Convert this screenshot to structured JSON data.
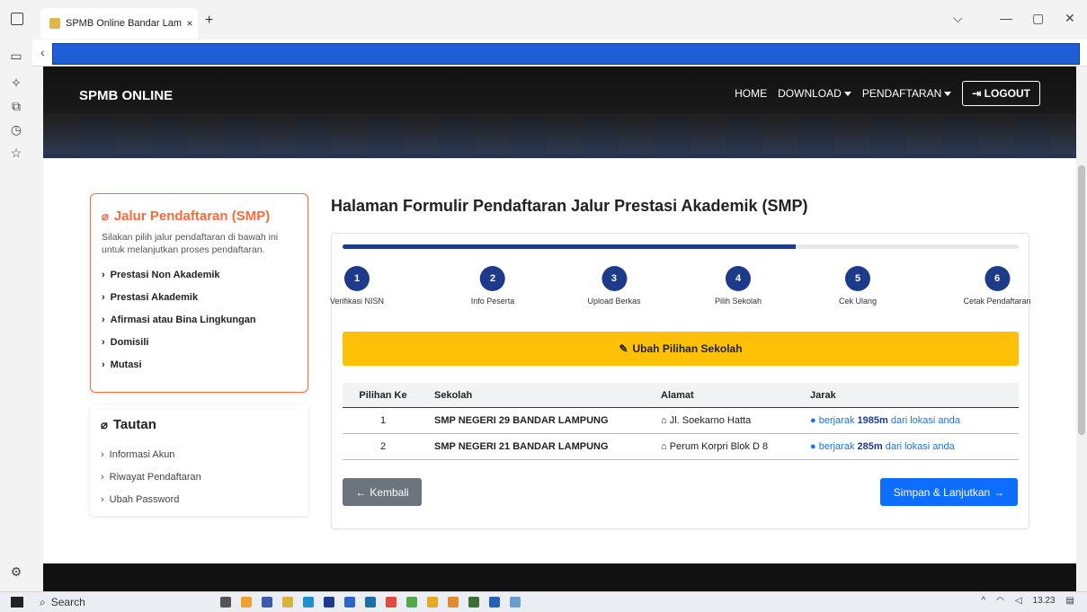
{
  "browser": {
    "tab_title": "SPMB Online Bandar Lampung",
    "tab_close": "×",
    "new_tab": "+",
    "win_min": "—",
    "win_max": "▢",
    "win_close": "✕",
    "dropdown": "⌵"
  },
  "header": {
    "brand": "SPMB ONLINE",
    "nav": [
      "HOME",
      "DOWNLOAD",
      "PENDAFTARAN"
    ],
    "logout": "LOGOUT"
  },
  "jalur_card": {
    "title": "Jalur Pendaftaran (SMP)",
    "description": "Silakan pilih jalur pendaftaran di bawah ini untuk melanjutkan proses pendaftaran.",
    "items": [
      "Prestasi Non Akademik",
      "Prestasi Akademik",
      "Afirmasi atau Bina Lingkungan",
      "Domisili",
      "Mutasi"
    ]
  },
  "tautan_card": {
    "title": "Tautan",
    "items": [
      "Informasi Akun",
      "Riwayat Pendaftaran",
      "Ubah Password"
    ]
  },
  "page_title": "Halaman Formulir Pendaftaran Jalur Prestasi Akademik (SMP)",
  "progress": {
    "fraction": 0.67
  },
  "steps": [
    {
      "num": "1",
      "label": "Verifikasi NISN"
    },
    {
      "num": "2",
      "label": "Info Peserta"
    },
    {
      "num": "3",
      "label": "Upload Berkas"
    },
    {
      "num": "4",
      "label": "Pilih Sekolah"
    },
    {
      "num": "5",
      "label": "Cek Ulang"
    },
    {
      "num": "6",
      "label": "Cetak Pendaftaran"
    }
  ],
  "ubah_button": "Ubah Pilihan Sekolah",
  "table": {
    "headers": [
      "Pilihan Ke",
      "Sekolah",
      "Alamat",
      "Jarak"
    ],
    "rows": [
      {
        "no": "1",
        "sekolah": "SMP NEGERI 29 BANDAR LAMPUNG",
        "alamat": "Jl. Soekarno Hatta",
        "jarak_pre": "berjarak ",
        "jarak_val": "1985m",
        "jarak_post": " dari lokasi anda"
      },
      {
        "no": "2",
        "sekolah": "SMP NEGERI 21 BANDAR LAMPUNG",
        "alamat": "Perum Korpri Blok D 8",
        "jarak_pre": "berjarak ",
        "jarak_val": "285m",
        "jarak_post": " dari lokasi anda"
      }
    ]
  },
  "btn_kembali": "Kembali",
  "btn_simpan": "Simpan & Lanjutkan",
  "taskbar": {
    "search": "Search",
    "time": "13.23"
  },
  "colors": {
    "accent_orange": "#f26d3d",
    "navy": "#1e3a8a",
    "yellow": "#ffc107",
    "primary": "#0d6efd"
  }
}
